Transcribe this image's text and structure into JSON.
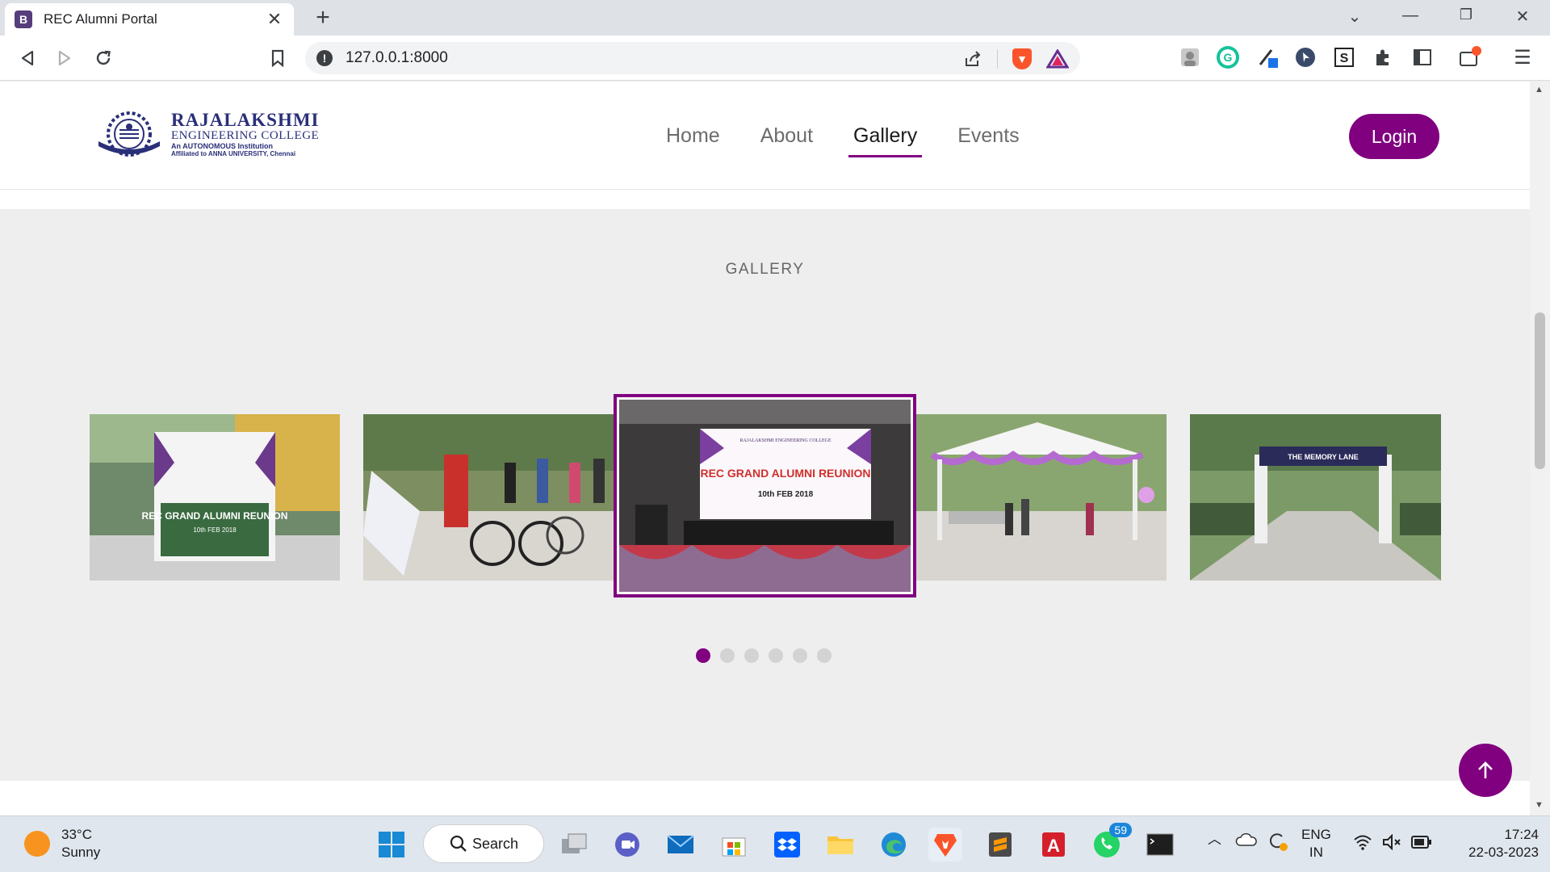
{
  "browser": {
    "tab_title": "REC Alumni Portal",
    "tab_favicon_letter": "B",
    "url": "127.0.0.1:8000"
  },
  "site": {
    "logo": {
      "line1": "RAJALAKSHMI",
      "line2": "ENGINEERING COLLEGE",
      "line3": "An AUTONOMOUS Institution",
      "line4": "Affiliated to ANNA UNIVERSITY, Chennai"
    },
    "nav": [
      {
        "label": "Home",
        "active": false
      },
      {
        "label": "About",
        "active": false
      },
      {
        "label": "Gallery",
        "active": true
      },
      {
        "label": "Events",
        "active": false
      }
    ],
    "login_label": "Login",
    "accent_color": "#800080"
  },
  "gallery": {
    "title": "GALLERY",
    "slides": [
      {
        "desc": "reunion-banner-outdoor",
        "banner_text": "REC GRAND ALUMNI REUNION",
        "date_text": "10th FEB 2018"
      },
      {
        "desc": "bicycles-and-standees"
      },
      {
        "desc": "stage-banner",
        "banner_text": "REC GRAND ALUMNI REUNION",
        "date_text": "10th FEB 2018",
        "header_text": "RAJALAKSHMI ENGINEERING COLLEGE"
      },
      {
        "desc": "tents-and-guests"
      },
      {
        "desc": "memory-lane-arch",
        "banner_text": "THE MEMORY LANE"
      }
    ],
    "active_dot": 0,
    "dot_count": 6
  },
  "taskbar": {
    "weather_temp": "33°C",
    "weather_desc": "Sunny",
    "search_label": "Search",
    "whatsapp_badge": "59",
    "lang_line1": "ENG",
    "lang_line2": "IN",
    "time": "17:24",
    "date": "22-03-2023"
  }
}
